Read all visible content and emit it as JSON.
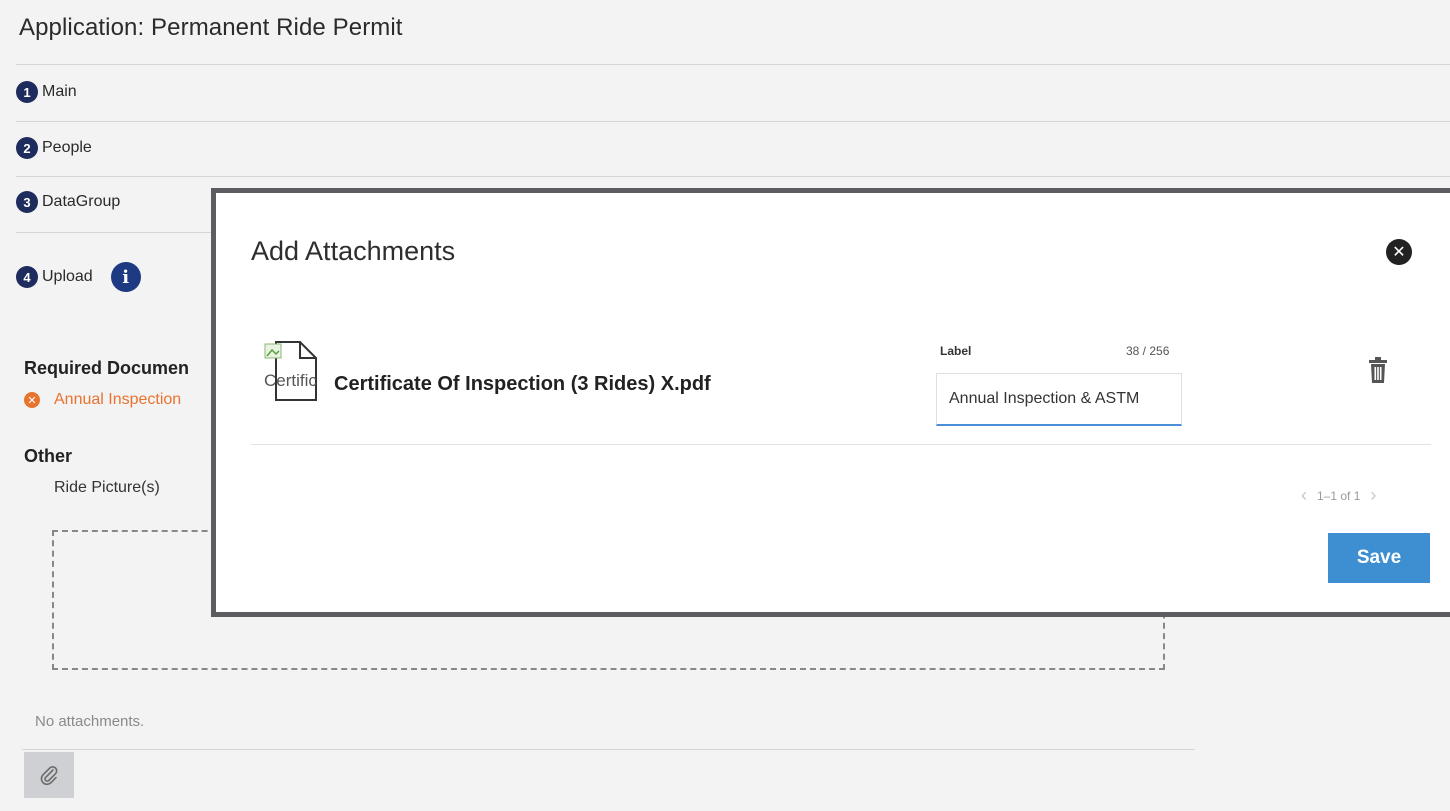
{
  "page": {
    "title": "Application: Permanent Ride Permit",
    "steps": [
      {
        "num": "1",
        "label": "Main"
      },
      {
        "num": "2",
        "label": "People"
      },
      {
        "num": "3",
        "label": "DataGroup"
      },
      {
        "num": "4",
        "label": "Upload"
      }
    ],
    "info_icon_glyph": "i",
    "required_heading": "Required Documen",
    "required_item": "Annual Inspection",
    "required_item_icon": "error-x-icon",
    "other_heading": "Other",
    "other_item": "Ride Picture(s)",
    "no_attachments": "No attachments.",
    "attach_icon": "paperclip-icon"
  },
  "modal": {
    "title": "Add Attachments",
    "close_glyph": "✕",
    "file": {
      "icon_alt": "Certific",
      "name": "Certificate Of Inspection (3 Rides) X.pdf",
      "label_caption": "Label",
      "char_count": "38 / 256",
      "label_value": "Annual Inspection & ASTM"
    },
    "pager": {
      "text": "1–1 of 1",
      "prev": "‹",
      "next": "›"
    },
    "save_label": "Save"
  },
  "colors": {
    "step_badge": "#1d2c5c",
    "error": "#e8732e",
    "primary_button": "#3d8fd2",
    "input_underline": "#4a90d9"
  }
}
